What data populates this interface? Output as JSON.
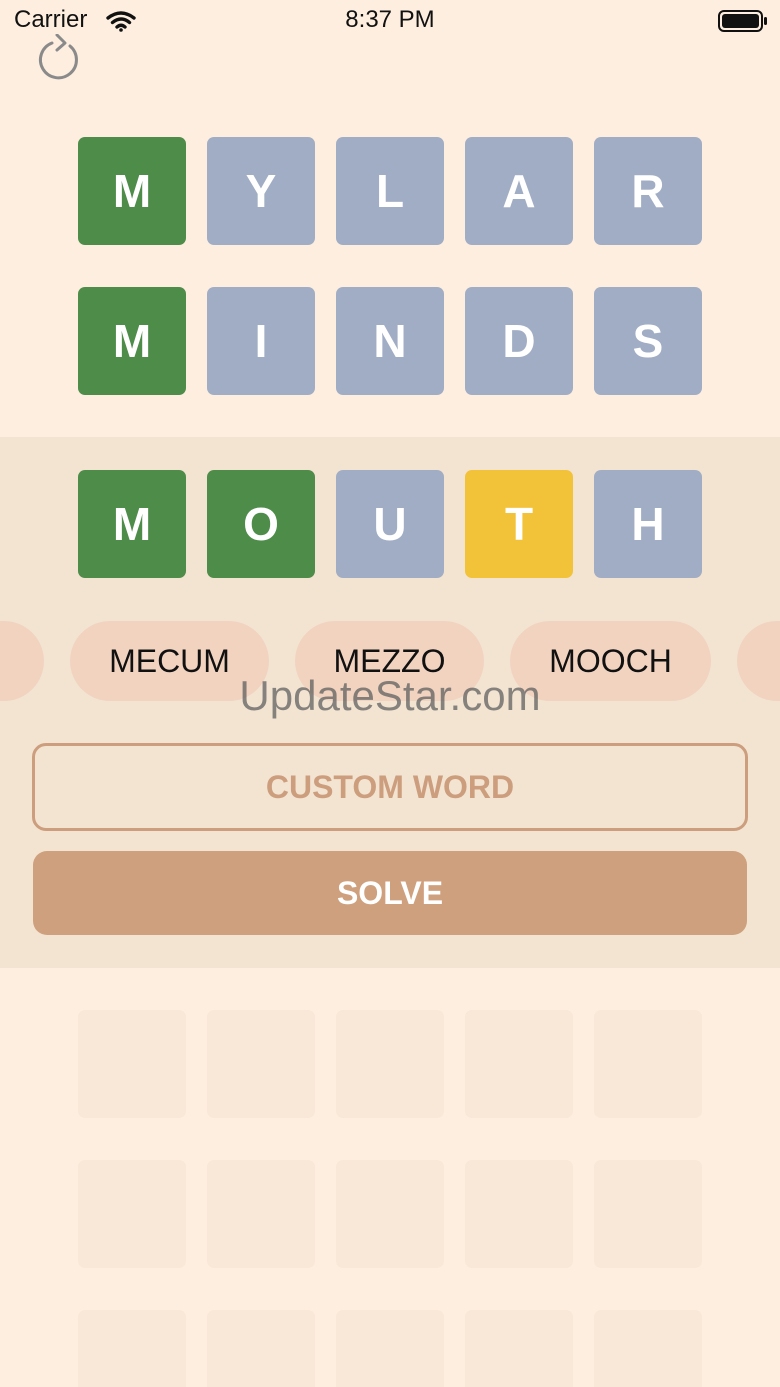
{
  "status": {
    "carrier": "Carrier",
    "time": "8:37 PM"
  },
  "toolbar": {
    "icon": "refresh-icon"
  },
  "guesses": [
    {
      "letters": [
        "M",
        "Y",
        "L",
        "A",
        "R"
      ],
      "states": [
        "green",
        "gray",
        "gray",
        "gray",
        "gray"
      ]
    },
    {
      "letters": [
        "M",
        "I",
        "N",
        "D",
        "S"
      ],
      "states": [
        "green",
        "gray",
        "gray",
        "gray",
        "gray"
      ]
    },
    {
      "letters": [
        "M",
        "O",
        "U",
        "T",
        "H"
      ],
      "states": [
        "green",
        "green",
        "gray",
        "yellow",
        "gray"
      ]
    }
  ],
  "suggestions": [
    "MECUM",
    "MEZZO",
    "MOOCH"
  ],
  "watermark": "UpdateStar.com",
  "custom_word": {
    "placeholder": "CUSTOM WORD",
    "value": ""
  },
  "solve_label": "SOLVE",
  "colors": {
    "background": "#FDEEDF",
    "panel": "#F3E4D2",
    "green": "#4E8C49",
    "gray": "#A1ADC4",
    "yellow": "#F2C338",
    "chip": "#F1D3C0",
    "accent": "#CFA07D",
    "empty_tile": "#F9E8D7"
  }
}
